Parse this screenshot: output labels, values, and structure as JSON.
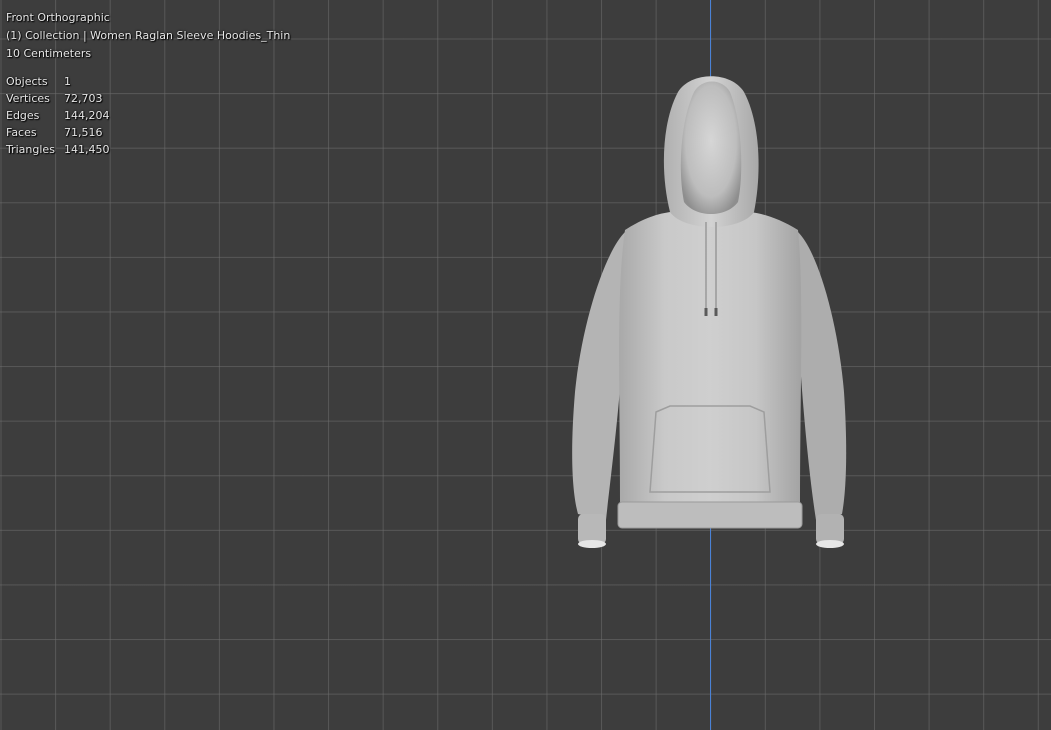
{
  "viewport": {
    "view_name": "Front Orthographic",
    "collection_info": "(1) Collection | Women Raglan Sleeve Hoodies_Thin",
    "grid_scale": "10 Centimeters",
    "axis_color": "#4a82d6",
    "background_color": "#3d3d3d",
    "model_color": "#c4c4c4"
  },
  "stats": [
    {
      "label": "Objects",
      "value": "1"
    },
    {
      "label": "Vertices",
      "value": "72,703"
    },
    {
      "label": "Edges",
      "value": "144,204"
    },
    {
      "label": "Faces",
      "value": "71,516"
    },
    {
      "label": "Triangles",
      "value": "141,450"
    }
  ]
}
